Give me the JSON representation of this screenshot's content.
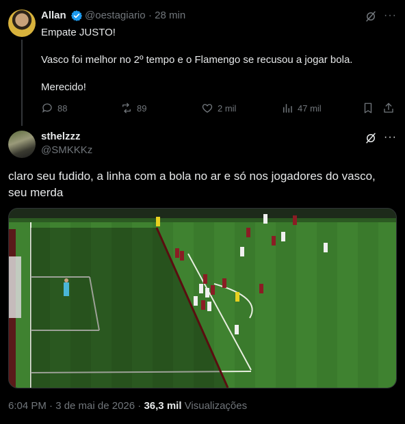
{
  "tweet": {
    "author_name": "Allan",
    "author_handle": "@oestagiario",
    "time": "· 28 min",
    "lines": [
      "Empate JUSTO!",
      "Vasco foi melhor no 2º tempo e o Flamengo se recusou a jogar bola.",
      "Merecido!"
    ],
    "actions": {
      "replies": "88",
      "retweets": "89",
      "likes": "2 mil",
      "views": "47 mil"
    }
  },
  "reply": {
    "author_name": "sthelzzz",
    "author_handle": "@SMKKKz",
    "text": "claro seu fudido, a linha com a bola no ar e só nos jogadores do vasco, seu merda",
    "media": {
      "type": "football-match-still",
      "description_icon": "soccer-offside-image"
    },
    "footer": {
      "timestamp": "6:04 PM · 3 de mai de 2026 ·",
      "views_count": "36,3 mil",
      "views_label": "Visualizações"
    }
  },
  "colors": {
    "background": "#000000",
    "text_primary": "#e7e9ea",
    "text_secondary": "#71767b",
    "verified": "#1d9bf0",
    "divider": "#333639",
    "pitch": "#3d7c2c"
  },
  "icons": [
    "verified-badge-icon",
    "grok-icon",
    "more-icon",
    "reply-icon",
    "retweet-icon",
    "like-icon",
    "views-icon",
    "bookmark-icon",
    "share-icon"
  ]
}
